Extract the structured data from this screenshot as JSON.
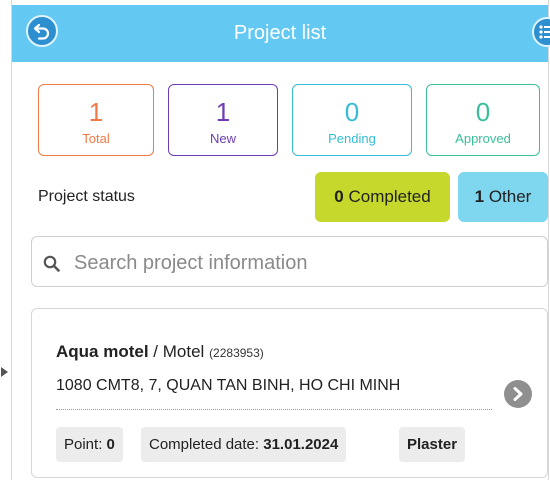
{
  "header": {
    "title": "Project list",
    "back_icon": "back-arrow-icon",
    "menu_icon": "list-menu-icon",
    "color": "#63c9f2"
  },
  "stats": [
    {
      "value": "1",
      "label": "Total",
      "color": "#f07a45"
    },
    {
      "value": "1",
      "label": "New",
      "color": "#6e3db4"
    },
    {
      "value": "0",
      "label": "Pending",
      "color": "#36bcd6"
    },
    {
      "value": "0",
      "label": "Approved",
      "color": "#3bbf9b"
    }
  ],
  "status": {
    "label": "Project status",
    "completed": {
      "count": "0",
      "text": "Completed",
      "color": "#c5d82b"
    },
    "other": {
      "count": "1",
      "text": "Other",
      "color": "#7fd6ef"
    }
  },
  "search": {
    "placeholder": "Search project information",
    "value": ""
  },
  "projects": [
    {
      "name": "Aqua motel",
      "type": "/ Motel",
      "code": "(2283953)",
      "address": "1080 CMT8, 7, QUAN TAN BINH, HO CHI MINH",
      "point_label": "Point:",
      "point_value": "0",
      "completed_label": "Completed date:",
      "completed_value": "31.01.2024",
      "product": "Plaster"
    }
  ]
}
